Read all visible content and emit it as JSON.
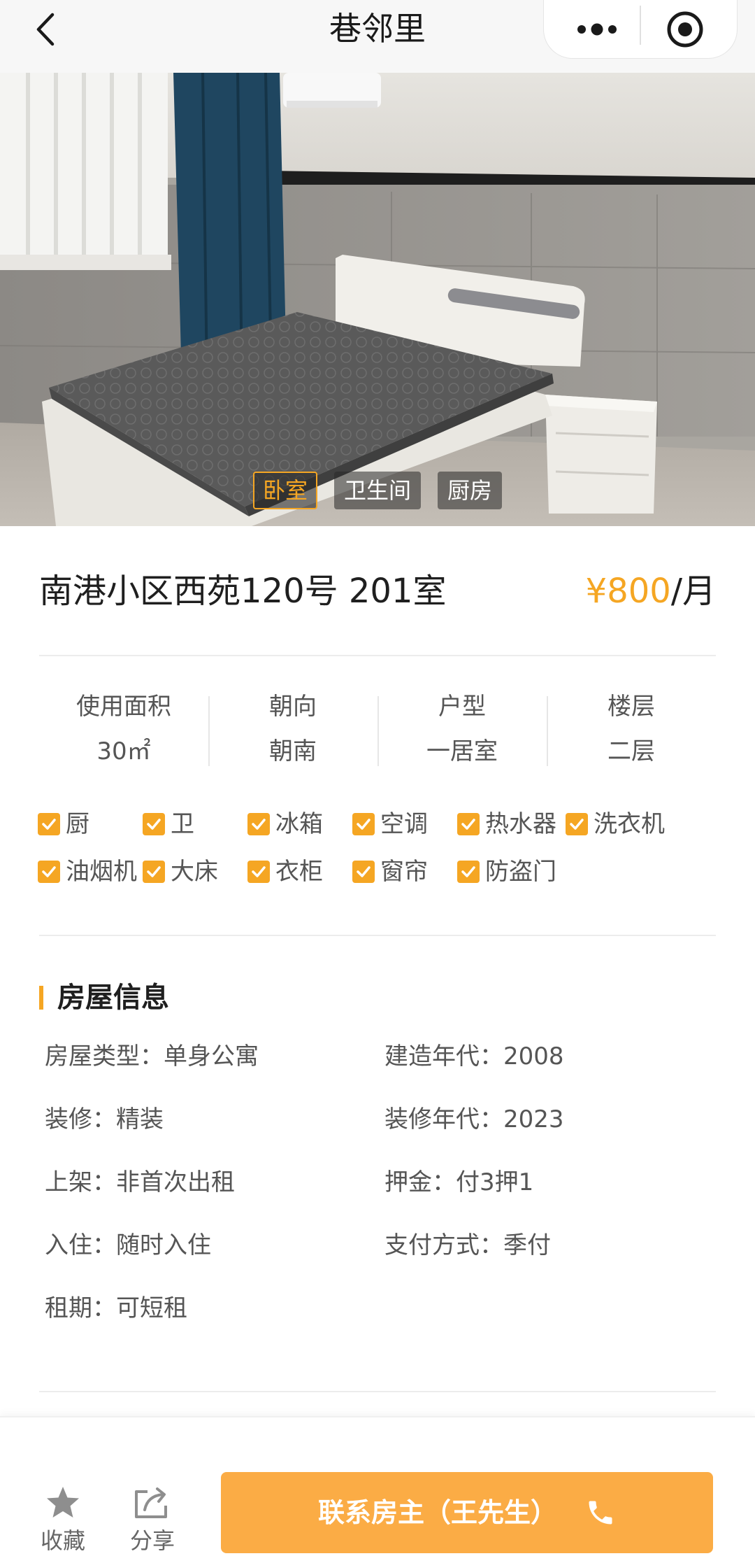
{
  "navbar": {
    "title": "巷邻里"
  },
  "photo": {
    "tabs": [
      {
        "label": "卧室",
        "active": true
      },
      {
        "label": "卫生间",
        "active": false
      },
      {
        "label": "厨房",
        "active": false
      }
    ]
  },
  "listing": {
    "title": "南港小区西苑120号 201室",
    "price_currency": "¥",
    "price_value": "800",
    "price_unit": "/月"
  },
  "specs": [
    {
      "label": "使用面积",
      "value": "30㎡"
    },
    {
      "label": "朝向",
      "value": "朝南"
    },
    {
      "label": "户型",
      "value": "一居室"
    },
    {
      "label": "楼层",
      "value": "二层"
    }
  ],
  "amenities": [
    "厨",
    "卫",
    "冰箱",
    "空调",
    "热水器",
    "洗衣机",
    "油烟机",
    "大床",
    "衣柜",
    "窗帘",
    "防盗门"
  ],
  "house_info": {
    "section_title": "房屋信息",
    "items": [
      "房屋类型：单身公寓",
      "建造年代：2008",
      "装修：精装",
      "装修年代：2023",
      "上架：非首次出租",
      "押金：付3押1",
      "入住：随时入住",
      "支付方式：季付",
      "租期：可短租"
    ]
  },
  "bottom_bar": {
    "favorite_label": "收藏",
    "share_label": "分享",
    "contact_label": "联系房主（王先生）"
  },
  "colors": {
    "accent": "#f5a623",
    "button": "#fbac45",
    "text_dark": "#1f1f1f",
    "text": "#555555"
  },
  "icons": {
    "back": "chevron-left-icon",
    "more": "more-dots-icon",
    "target": "target-icon",
    "check": "checkbox-checked-icon",
    "favorite": "star-icon",
    "share": "share-icon",
    "phone": "phone-icon"
  }
}
